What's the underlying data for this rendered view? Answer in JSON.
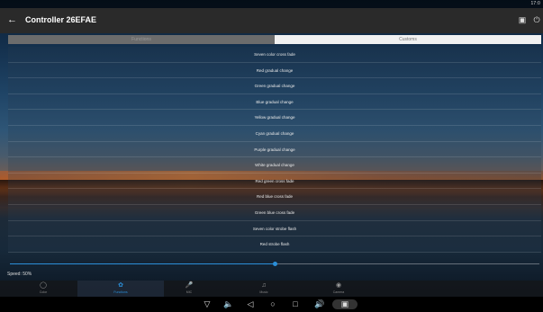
{
  "status_bar": {
    "time": "17:0"
  },
  "toolbar": {
    "back_icon": "arrow-left-icon",
    "title": "Controller  26EFAE",
    "actions": [
      "screen-icon",
      "power-icon"
    ]
  },
  "tabs": [
    {
      "label": "Functions",
      "active": false
    },
    {
      "label": "Customs",
      "active": true
    }
  ],
  "modes": [
    "Seven color cross fade",
    "Red gradual change",
    "Green gradual change",
    "Blue gradual change",
    "Yellow gradual change",
    "Cyan gradual change",
    "Purple gradual change",
    "White gradual change",
    "Red green cross fade",
    "Red blue cross fade",
    "Green blue cross fade",
    "Seven color strobe flash",
    "Red strobe flash"
  ],
  "speed": {
    "label": "Speed: 50%",
    "value": 0.5
  },
  "bottom_nav": [
    {
      "label": "Color",
      "icon": "palette-icon",
      "active": false
    },
    {
      "label": "Functions",
      "icon": "functions-icon",
      "active": true
    },
    {
      "label": "MIC",
      "icon": "microphone-icon",
      "active": false
    },
    {
      "label": "Music",
      "icon": "music-note-icon",
      "active": false
    },
    {
      "label": "Camera",
      "icon": "camera-icon",
      "active": false
    }
  ],
  "colors": {
    "accent": "#2b8fd9",
    "toolbar": "#2a2a2a"
  }
}
